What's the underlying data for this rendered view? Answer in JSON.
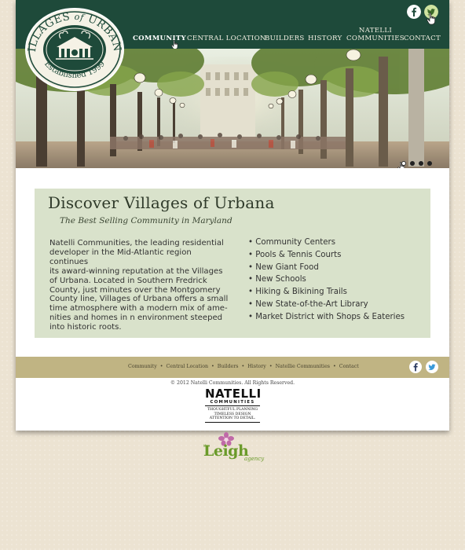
{
  "logo": {
    "name": "VILLAGES of URBANA",
    "name_main": "VILLAGES",
    "name_of": "of",
    "name_town": "URBANA",
    "established": "Established 1999"
  },
  "nav": {
    "items": [
      {
        "label": "COMMUNITY",
        "active": true
      },
      {
        "label": "CENTRAL LOCATION",
        "active": false
      },
      {
        "label": "BUILDERS",
        "active": false
      },
      {
        "label": "HISTORY",
        "active": false
      },
      {
        "label_line1": "NATELLI",
        "label_line2": "COMMUNITIES",
        "active": false
      },
      {
        "label": "CONTACT",
        "active": false
      }
    ]
  },
  "social": {
    "facebook_icon": "facebook-icon",
    "twitter_icon": "twitter-icon"
  },
  "hero": {
    "slides": 4,
    "active_slide": 1
  },
  "feature": {
    "title": "Discover Villages of Urbana",
    "subtitle": "The Best Selling Community in Maryland",
    "body_lines": [
      "Natelli Communities, the leading residential",
      "developer in the Mid-Atlantic region continues",
      "its award-winning reputation at the Villages",
      "of Urbana. Located in Southern Fredrick",
      "County, just minutes over the Montgomery",
      "County line, Villages of Urbana offers a small",
      "time atmosphere with a modern mix of ame-",
      "nities and homes in n environment steeped",
      "into historic roots."
    ],
    "amenities": [
      "Community Centers",
      "Pools & Tennis Courts",
      "New Giant Food",
      "New Schools",
      "Hiking & Bikining Trails",
      "New State-of-the-Art Library",
      "Market District with Shops & Eateries"
    ]
  },
  "footer": {
    "links": [
      "Community",
      "Central Location",
      "Builders",
      "History",
      "Natellie Communities",
      "Contact"
    ],
    "separator": "•",
    "copyright": "© 2012 Natelli Communities. All Rights Reserved.",
    "natelli_brand": "NATELLI",
    "natelli_brand2": "COMMUNITIES",
    "natelli_tagline": [
      "THOUGHTFUL PLANNING",
      "TIMELESS DESIGN",
      "ATTENTION TO DETAIL."
    ]
  },
  "agency": {
    "the": "the",
    "name": "Leigh",
    "suffix": "agency"
  },
  "colors": {
    "header": "#1e4a3a",
    "feature_bg": "#d9e2cb",
    "footer_bar": "#c0b483",
    "page_bg": "#ece3d2",
    "agency_green": "#6a9a2a",
    "agency_flower": "#c06aa8"
  }
}
